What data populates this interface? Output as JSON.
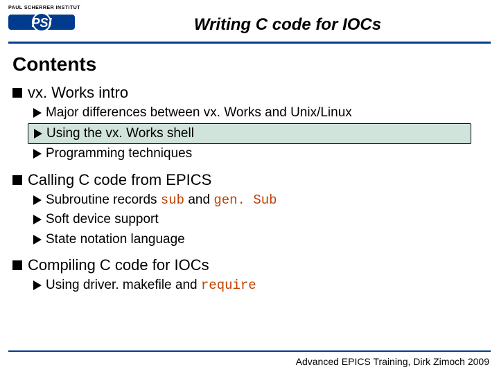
{
  "header": {
    "logo_small": "PAUL SCHERRER INSTITUT",
    "logo_text": "PSI",
    "title": "Writing C code for IOCs"
  },
  "content": {
    "heading": "Contents",
    "sections": [
      {
        "title": "vx. Works intro",
        "items": [
          {
            "text": "Major differences between vx. Works and Unix/Linux",
            "highlighted": false
          },
          {
            "text": "Using the vx. Works shell",
            "highlighted": true
          },
          {
            "text": "Programming techniques",
            "highlighted": false
          }
        ]
      },
      {
        "title": "Calling C code from EPICS",
        "items": [
          {
            "prefix": "Subroutine records ",
            "code1": "sub",
            "mid": " and ",
            "code2": "gen. Sub"
          },
          {
            "text": "Soft device support"
          },
          {
            "text": "State notation language"
          }
        ]
      },
      {
        "title": "Compiling C code for IOCs",
        "items": [
          {
            "prefix": "Using driver. makefile and ",
            "code1": "require"
          }
        ]
      }
    ]
  },
  "footer": {
    "text": "Advanced EPICS Training, Dirk Zimoch 2009"
  }
}
